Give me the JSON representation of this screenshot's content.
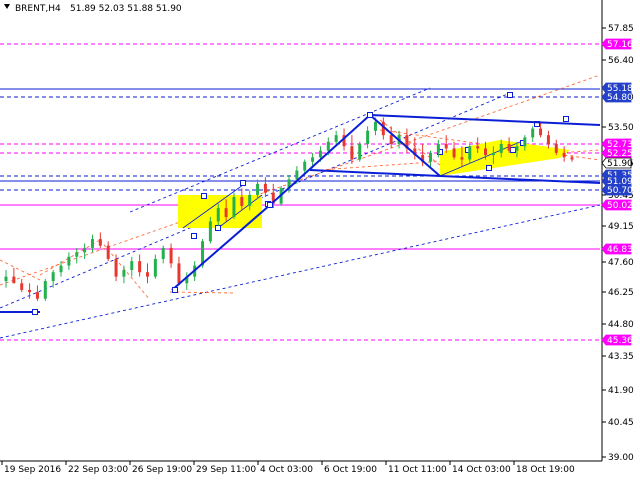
{
  "header": {
    "symbol": "BRENT,H4",
    "ohlc": "51.89 52.03 51.88 51.90"
  },
  "colors": {
    "bull": "#22b14c",
    "bear": "#e8372e",
    "neutral": "#000000",
    "level": "#ff00ff",
    "trend": "#0b1fd6",
    "triangle": "#ffff00",
    "price_tag": "#ffffff",
    "blue_tag": "#2540c8",
    "magenta_tag": "#ff00ff",
    "dashed_red": "#ff6b3a"
  },
  "y_axis": {
    "ticks": [
      "57.85",
      "56.40",
      "54.80",
      "53.50",
      "51.95",
      "50.45",
      "49.15",
      "47.60",
      "46.25",
      "44.80",
      "43.35",
      "41.90",
      "40.45",
      "39.00"
    ]
  },
  "x_axis": {
    "ticks": [
      "19 Sep 2016",
      "22 Sep 03:00",
      "26 Sep 19:00",
      "29 Sep 11:00",
      "4 Oct 03:00",
      "6 Oct 19:00",
      "11 Oct 11:00",
      "14 Oct 03:00",
      "18 Oct 19:00"
    ]
  },
  "price_tags": [
    {
      "label": "57.16",
      "kind": "magenta"
    },
    {
      "label": "55.18",
      "kind": "blue"
    },
    {
      "label": "54.80",
      "kind": "blue"
    },
    {
      "label": "52.73",
      "kind": "magenta"
    },
    {
      "label": "52.25",
      "kind": "magenta"
    },
    {
      "label": "51.90",
      "kind": "current"
    },
    {
      "label": "51.35",
      "kind": "blue"
    },
    {
      "label": "51.09",
      "kind": "blue"
    },
    {
      "label": "50.70",
      "kind": "blue"
    },
    {
      "label": "50.02",
      "kind": "magenta"
    },
    {
      "label": "46.83",
      "kind": "magenta"
    },
    {
      "label": "45.36",
      "kind": "magenta"
    }
  ],
  "chart_data": {
    "type": "candlestick",
    "title": "BRENT,H4",
    "current_price": 51.9,
    "ylim": [
      39.0,
      58.3
    ],
    "candles": [
      [
        46.4,
        46.9,
        46.1,
        46.6
      ],
      [
        46.6,
        47.0,
        46.3,
        46.3
      ],
      [
        46.3,
        46.5,
        45.9,
        46.0
      ],
      [
        46.0,
        46.3,
        45.6,
        45.9
      ],
      [
        45.9,
        46.2,
        45.5,
        45.6
      ],
      [
        45.6,
        46.5,
        45.5,
        46.4
      ],
      [
        46.4,
        46.9,
        46.1,
        46.8
      ],
      [
        46.8,
        47.3,
        46.6,
        47.1
      ],
      [
        47.1,
        47.7,
        46.9,
        47.5
      ],
      [
        47.5,
        47.9,
        47.2,
        47.7
      ],
      [
        47.7,
        48.1,
        47.4,
        47.9
      ],
      [
        47.9,
        48.5,
        47.7,
        48.3
      ],
      [
        48.3,
        48.6,
        47.9,
        48.0
      ],
      [
        48.0,
        48.2,
        47.3,
        47.4
      ],
      [
        47.4,
        47.6,
        46.4,
        46.6
      ],
      [
        46.6,
        47.1,
        46.3,
        46.9
      ],
      [
        46.9,
        47.5,
        46.6,
        47.3
      ],
      [
        47.3,
        47.6,
        46.6,
        46.8
      ],
      [
        46.8,
        47.2,
        46.3,
        46.6
      ],
      [
        46.6,
        47.6,
        46.5,
        47.4
      ],
      [
        47.4,
        48.0,
        47.2,
        47.9
      ],
      [
        47.9,
        48.1,
        47.0,
        47.2
      ],
      [
        47.2,
        47.5,
        46.2,
        46.3
      ],
      [
        46.3,
        46.8,
        46.0,
        46.6
      ],
      [
        46.6,
        47.3,
        46.4,
        47.1
      ],
      [
        47.1,
        48.3,
        47.0,
        48.2
      ],
      [
        48.2,
        49.3,
        48.1,
        49.1
      ],
      [
        49.1,
        49.9,
        48.9,
        49.7
      ],
      [
        49.7,
        50.1,
        49.1,
        49.3
      ],
      [
        49.3,
        50.4,
        49.2,
        50.2
      ],
      [
        50.2,
        50.6,
        49.6,
        49.8
      ],
      [
        49.8,
        50.5,
        49.6,
        50.3
      ],
      [
        50.3,
        51.0,
        50.1,
        50.8
      ],
      [
        50.8,
        51.1,
        50.2,
        50.4
      ],
      [
        50.4,
        50.8,
        49.7,
        49.9
      ],
      [
        49.9,
        50.7,
        49.8,
        50.6
      ],
      [
        50.6,
        51.2,
        50.4,
        51.0
      ],
      [
        51.0,
        51.6,
        50.8,
        51.4
      ],
      [
        51.4,
        51.9,
        51.2,
        51.8
      ],
      [
        51.8,
        52.2,
        51.5,
        52.0
      ],
      [
        52.0,
        52.5,
        51.8,
        52.3
      ],
      [
        52.3,
        52.9,
        52.1,
        52.7
      ],
      [
        52.7,
        53.2,
        52.5,
        53.0
      ],
      [
        53.0,
        53.3,
        52.3,
        52.5
      ],
      [
        52.5,
        53.0,
        51.7,
        51.9
      ],
      [
        51.9,
        52.7,
        51.8,
        52.6
      ],
      [
        52.6,
        53.4,
        52.4,
        53.2
      ],
      [
        53.2,
        53.8,
        53.0,
        53.6
      ],
      [
        53.6,
        53.8,
        52.8,
        53.0
      ],
      [
        53.0,
        53.4,
        52.4,
        52.6
      ],
      [
        52.6,
        53.2,
        52.4,
        53.0
      ],
      [
        53.0,
        53.3,
        52.2,
        52.4
      ],
      [
        52.4,
        52.9,
        51.9,
        52.1
      ],
      [
        52.1,
        52.6,
        51.6,
        51.8
      ],
      [
        51.8,
        52.3,
        51.5,
        52.2
      ],
      [
        52.2,
        52.8,
        52.0,
        52.6
      ],
      [
        52.6,
        53.0,
        52.2,
        52.4
      ],
      [
        52.4,
        52.7,
        51.9,
        52.0
      ],
      [
        52.0,
        52.5,
        51.6,
        51.9
      ],
      [
        51.9,
        52.6,
        51.7,
        52.5
      ],
      [
        52.5,
        52.9,
        52.2,
        52.4
      ],
      [
        52.4,
        52.7,
        51.9,
        52.1
      ],
      [
        52.1,
        52.5,
        51.7,
        52.2
      ],
      [
        52.2,
        52.8,
        52.0,
        52.6
      ],
      [
        52.6,
        52.9,
        52.2,
        52.3
      ],
      [
        52.3,
        52.7,
        52.0,
        52.5
      ],
      [
        52.5,
        53.0,
        52.3,
        52.9
      ],
      [
        52.9,
        53.4,
        52.7,
        53.3
      ],
      [
        53.3,
        53.6,
        52.9,
        53.0
      ],
      [
        53.0,
        53.2,
        52.4,
        52.6
      ],
      [
        52.6,
        52.8,
        52.1,
        52.2
      ],
      [
        52.2,
        52.5,
        51.8,
        52.0
      ],
      [
        52.0,
        52.1,
        51.8,
        51.9
      ]
    ]
  }
}
